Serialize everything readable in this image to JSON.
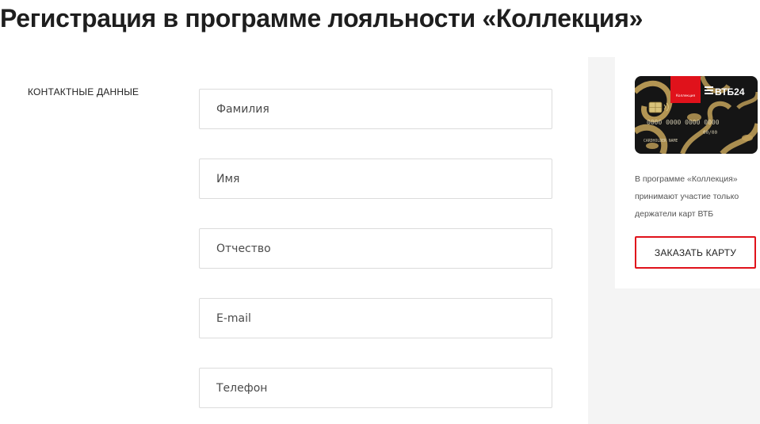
{
  "page": {
    "title": "Регистрация в программе лояльности «Коллекция»"
  },
  "form": {
    "section_label": "КОНТАКТНЫЕ ДАННЫЕ",
    "fields": [
      {
        "name": "last-name",
        "placeholder": "Фамилия",
        "value": ""
      },
      {
        "name": "first-name",
        "placeholder": "Имя",
        "value": ""
      },
      {
        "name": "patronymic",
        "placeholder": "Отчество",
        "value": ""
      },
      {
        "name": "email",
        "placeholder": "E-mail",
        "value": ""
      },
      {
        "name": "phone",
        "placeholder": "Телефон",
        "value": ""
      }
    ]
  },
  "sidebar": {
    "card": {
      "program_logo": "Коллекция",
      "bank_logo": "ВТБ24",
      "number": "0000 0000 0000 0000",
      "valid": "00/00",
      "holder": "CARDHOLDER NAME",
      "colors": {
        "base": "#151515",
        "gold": "#c4a35a",
        "label_red": "#e0121b"
      }
    },
    "note": "В программе «Коллекция» принимают участие только держатели карт ВТБ",
    "order_button_label": "ЗАКАЗАТЬ КАРТУ"
  },
  "colors": {
    "page_background": "#f4f4f4",
    "panel_background": "#ffffff",
    "field_border": "#dcdcdc",
    "accent_red": "#e0121b"
  }
}
